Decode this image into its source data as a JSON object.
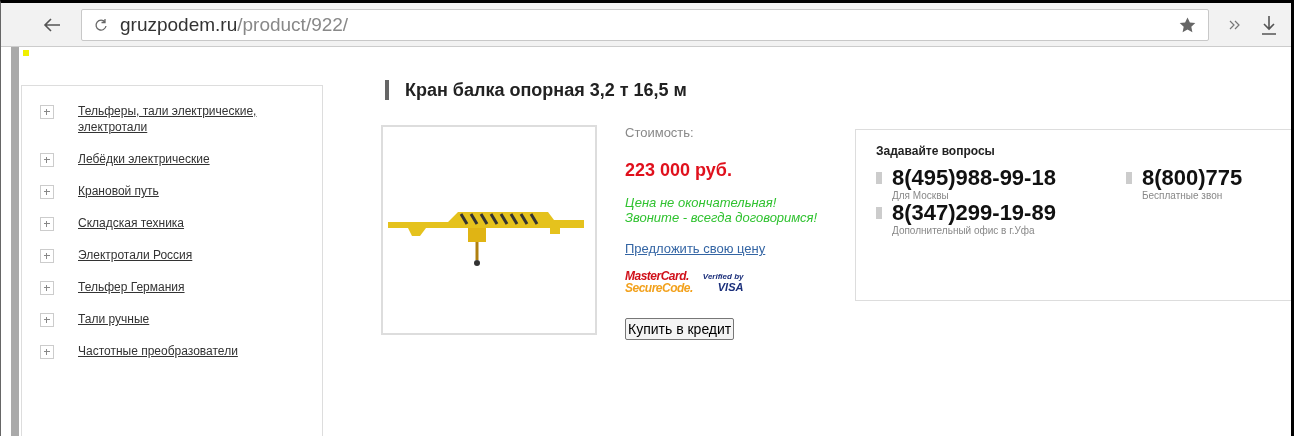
{
  "browser": {
    "url_host": "gruzpodem.ru",
    "url_path": "/product/922/"
  },
  "sidebar": {
    "items": [
      {
        "label": "Тельферы, тали электрические, электротали",
        "expanded": false
      },
      {
        "label": "Лебёдки электрические",
        "expanded": false
      },
      {
        "label": "Крановой путь",
        "expanded": false
      },
      {
        "label": "Складская техника",
        "expanded": false
      },
      {
        "label": "Электротали Россия",
        "expanded": false
      },
      {
        "label": "Тельфер Германия",
        "expanded": false
      },
      {
        "label": "Тали ручные",
        "expanded": false
      },
      {
        "label": "Частотные преобразователи",
        "expanded": false
      }
    ]
  },
  "product": {
    "title": "Кран балка опорная 3,2 т 16,5 м",
    "price_label": "Стоимость:",
    "price": "223 000 руб.",
    "note": "Цена не окончательная! Звоните - всегда договоримся!",
    "offer_link": "Предложить свою цену",
    "badges": [
      {
        "kind": "mastercard",
        "line1": "MasterCard.",
        "line2": "SecureCode."
      },
      {
        "kind": "visa",
        "line1": "Verified by",
        "line2": "VISA"
      }
    ],
    "credit_button": "Купить в кредит"
  },
  "contacts": {
    "title": "Задавайте вопросы",
    "phones": [
      {
        "number": "8(495)988-99-18",
        "caption": "Для Москвы"
      },
      {
        "number": "8(800)775",
        "caption": "Бесплатные звон"
      },
      {
        "number": "8(347)299-19-89",
        "caption": "Дополнительный офис в г.Уфа"
      }
    ]
  }
}
